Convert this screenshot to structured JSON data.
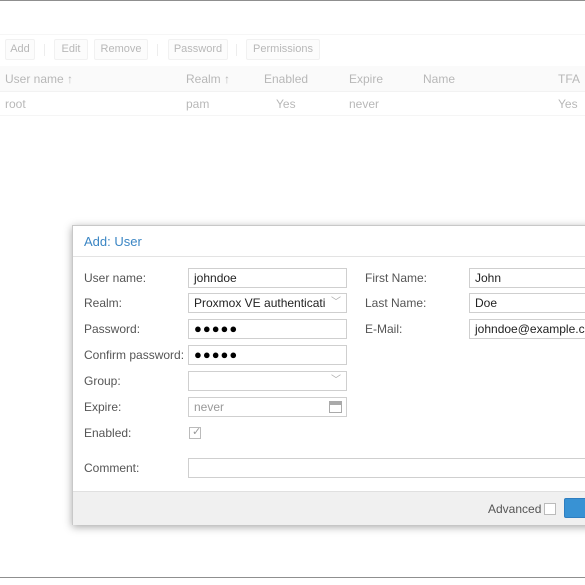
{
  "toolbar": {
    "add": "Add",
    "edit": "Edit",
    "remove": "Remove",
    "password": "Password",
    "permissions": "Permissions"
  },
  "grid": {
    "columns": [
      "User name",
      "Realm",
      "Enabled",
      "Expire",
      "Name",
      "TFA"
    ],
    "sort_indicator": "↑",
    "rows": [
      {
        "user": "root",
        "realm": "pam",
        "enabled": "Yes",
        "expire": "never",
        "name": "",
        "tfa": "Yes"
      }
    ]
  },
  "dialog": {
    "title": "Add: User",
    "labels": {
      "username": "User name:",
      "realm": "Realm:",
      "password": "Password:",
      "confirm": "Confirm password:",
      "group": "Group:",
      "expire": "Expire:",
      "enabled": "Enabled:",
      "comment": "Comment:",
      "firstname": "First Name:",
      "lastname": "Last Name:",
      "email": "E-Mail:"
    },
    "values": {
      "username": "johndoe",
      "realm": "Proxmox VE authenticati",
      "password": "●●●●●",
      "confirm": "●●●●●",
      "group": "",
      "expire_placeholder": "never",
      "comment": "",
      "firstname": "John",
      "lastname": "Doe",
      "email": "johndoe@example.co"
    },
    "enabled_checked": true,
    "advanced_label": "Advanced",
    "advanced_checked": false
  },
  "colors": {
    "accent": "#3b86c4",
    "primary_button": "#3892d4"
  }
}
